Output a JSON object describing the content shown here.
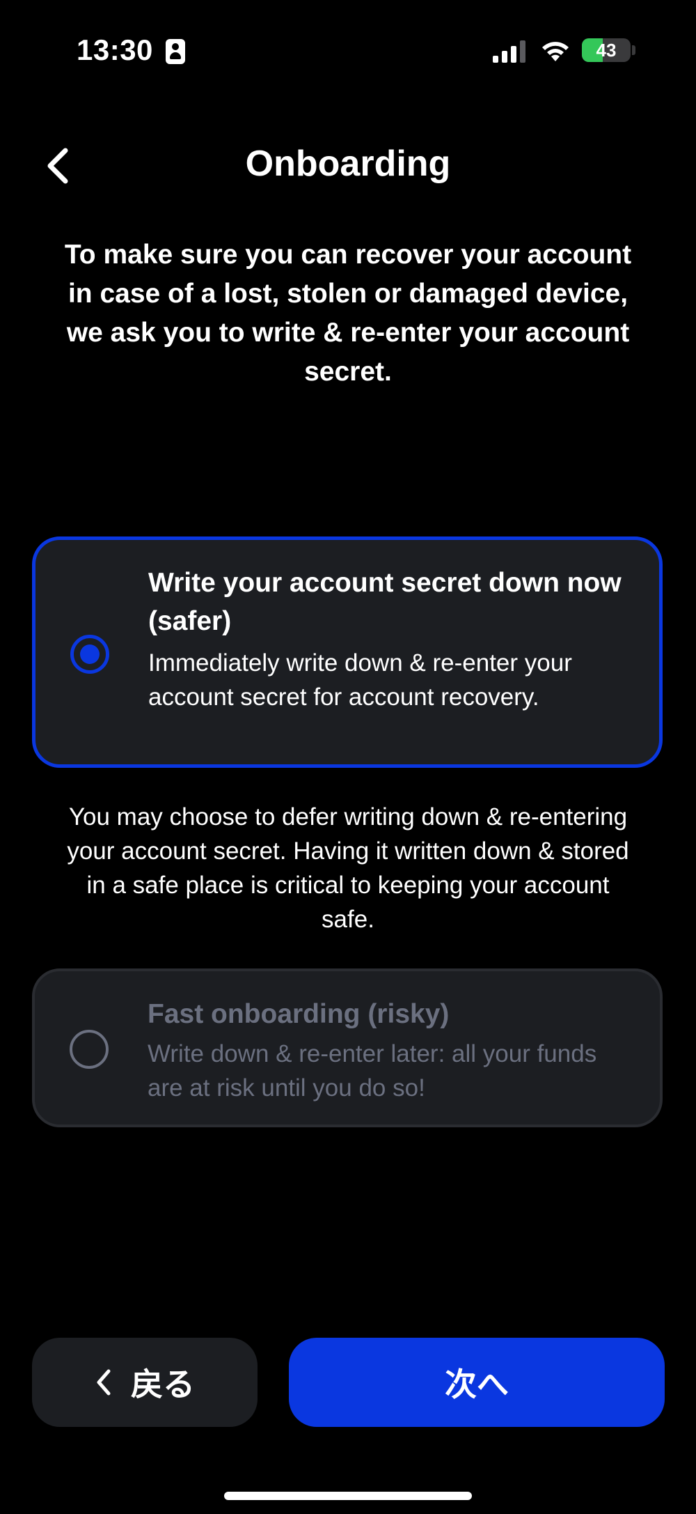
{
  "status_bar": {
    "time": "13:30",
    "battery_level": "43",
    "battery_fraction": 0.43,
    "battery_color": "#34c759"
  },
  "header": {
    "title": "Onboarding",
    "back_icon": "chevron-left-icon"
  },
  "intro": "To make sure you can recover your account in case of a lost, stolen or damaged device, we ask you to write & re-enter your account secret.",
  "options": [
    {
      "title": "Write your account secret down now (safer)",
      "description": "Immediately write down & re-enter your account secret for account recovery.",
      "selected": true
    },
    {
      "title": "Fast onboarding (risky)",
      "description": "Write down & re-enter later: all your funds are at risk until you do so!",
      "selected": false
    }
  ],
  "defer_note": "You may choose to defer writing down & re-entering your account secret. Having it written down & stored in a safe place is critical to keeping your account safe.",
  "footer": {
    "back_label": "戻る",
    "next_label": "次へ"
  },
  "colors": {
    "accent": "#0a37e0",
    "card_bg": "#1c1e22",
    "muted_text": "#6b7080",
    "background": "#000000"
  }
}
